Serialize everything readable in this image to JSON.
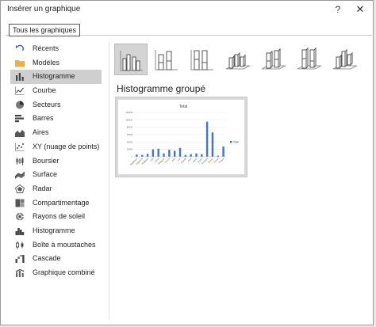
{
  "window": {
    "title": "Insérer un graphique",
    "help": "?",
    "close": "✕"
  },
  "tabs": [
    {
      "label": "Tous les graphiques"
    }
  ],
  "sidebar": {
    "items": [
      {
        "label": "Récents",
        "icon": "undo-icon"
      },
      {
        "label": "Modèles",
        "icon": "folder-icon"
      },
      {
        "label": "Histogramme",
        "icon": "column-chart-icon",
        "selected": true
      },
      {
        "label": "Courbe",
        "icon": "line-chart-icon"
      },
      {
        "label": "Secteurs",
        "icon": "pie-chart-icon"
      },
      {
        "label": "Barres",
        "icon": "bar-chart-icon"
      },
      {
        "label": "Aires",
        "icon": "area-chart-icon"
      },
      {
        "label": "XY (nuage de points)",
        "icon": "scatter-chart-icon"
      },
      {
        "label": "Boursier",
        "icon": "stock-chart-icon"
      },
      {
        "label": "Surface",
        "icon": "surface-chart-icon"
      },
      {
        "label": "Radar",
        "icon": "radar-chart-icon"
      },
      {
        "label": "Compartimentage",
        "icon": "treemap-chart-icon"
      },
      {
        "label": "Rayons de soleil",
        "icon": "sunburst-chart-icon"
      },
      {
        "label": "Histogramme",
        "icon": "histogram-chart-icon"
      },
      {
        "label": "Boîte à moustaches",
        "icon": "box-whisker-chart-icon"
      },
      {
        "label": "Cascade",
        "icon": "waterfall-chart-icon"
      },
      {
        "label": "Graphique combiné",
        "icon": "combo-chart-icon"
      }
    ]
  },
  "chart_types": [
    {
      "name": "clustered-column",
      "selected": true
    },
    {
      "name": "stacked-column"
    },
    {
      "name": "100-stacked-column"
    },
    {
      "name": "3d-clustered-column"
    },
    {
      "name": "3d-stacked-column"
    },
    {
      "name": "3d-100-stacked-column"
    },
    {
      "name": "3d-column"
    }
  ],
  "selected_type_title": "Histogramme groupé",
  "colors": {
    "accent": "#4472c4",
    "selected_bg": "#cfcfcf"
  },
  "preview": {
    "chart_data": {
      "type": "bar",
      "title": "Total",
      "categories": [
        "Angleterre",
        "Argentine",
        "Belgique",
        "Chili",
        "Chine",
        "Espagne",
        "France",
        "Inde",
        "Iran",
        "Islande",
        "Italie",
        "Japon",
        "Maroc",
        "Portugal",
        "Russie",
        "Suisse",
        "Turquie"
      ],
      "series": [
        {
          "name": "Total",
          "values": [
            6000,
            5000,
            8000,
            20000,
            22000,
            9000,
            19000,
            16000,
            24000,
            5000,
            7000,
            9000,
            7000,
            95000,
            66000,
            3000,
            28000
          ]
        }
      ],
      "ylim": [
        0,
        120000
      ],
      "yticks": [
        "0",
        "20000",
        "40000",
        "60000",
        "80000",
        "100000",
        "120000"
      ],
      "legend": "right",
      "grid": true
    }
  }
}
